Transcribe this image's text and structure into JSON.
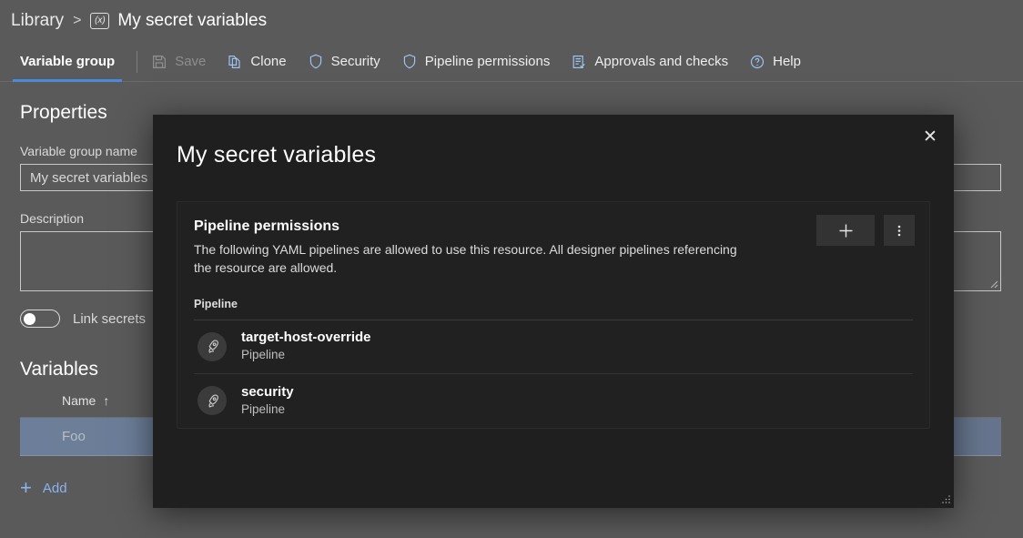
{
  "colors": {
    "page_bg": "#5a5a5a",
    "dialog_bg": "#1f1f1f",
    "accent": "#4a89dc",
    "link": "#8ab4f0",
    "row_selected": "#6c7e99"
  },
  "breadcrumb": {
    "root": "Library",
    "separator": ">",
    "icon": "variable-group-icon",
    "icon_glyph": "(x)",
    "title": "My secret variables"
  },
  "toolbar": {
    "tab": "Variable group",
    "items": [
      {
        "label": "Save",
        "icon": "save-icon",
        "disabled": true
      },
      {
        "label": "Clone",
        "icon": "clone-icon",
        "disabled": false
      },
      {
        "label": "Security",
        "icon": "shield-icon",
        "disabled": false
      },
      {
        "label": "Pipeline permissions",
        "icon": "shield-icon",
        "disabled": false
      },
      {
        "label": "Approvals and checks",
        "icon": "checklist-icon",
        "disabled": false
      },
      {
        "label": "Help",
        "icon": "help-icon",
        "disabled": false
      }
    ]
  },
  "properties": {
    "heading": "Properties",
    "name_label": "Variable group name",
    "name_value": "My secret variables",
    "description_label": "Description",
    "description_value": "",
    "toggle_label": "Link secrets",
    "toggle_on": false
  },
  "variables": {
    "heading": "Variables",
    "columns": [
      "Name"
    ],
    "sort_glyph": "↑",
    "rows": [
      {
        "name": "Foo",
        "selected": true
      }
    ],
    "add_label": "Add",
    "add_glyph": "+"
  },
  "dialog": {
    "title": "My secret variables",
    "close_glyph": "✕",
    "card": {
      "title": "Pipeline permissions",
      "description": "The following YAML pipelines are allowed to use this resource. All designer pipelines referencing the resource are allowed.",
      "add_glyph": "+",
      "more_glyph": "⋮",
      "list_header": "Pipeline",
      "rows": [
        {
          "name": "target-host-override",
          "subtitle": "Pipeline",
          "icon": "rocket-icon"
        },
        {
          "name": "security",
          "subtitle": "Pipeline",
          "icon": "rocket-icon"
        }
      ]
    }
  }
}
